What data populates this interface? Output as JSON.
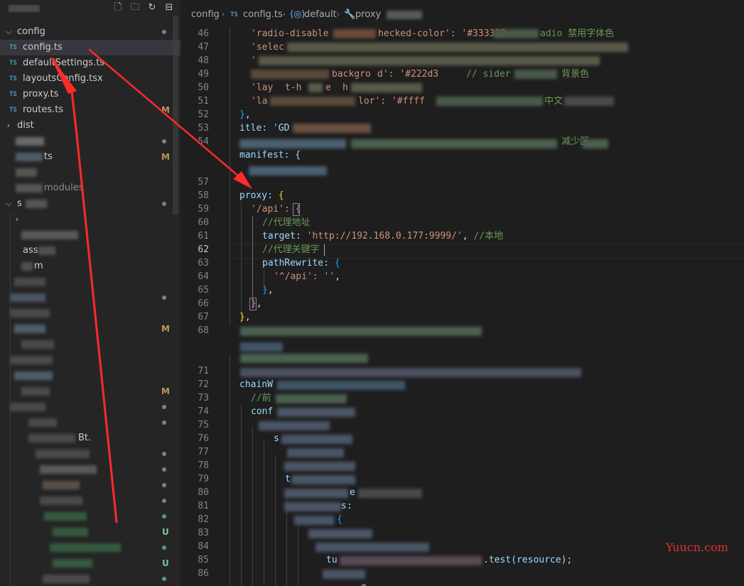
{
  "sidebar": {
    "actions": [
      "new-file-icon",
      "new-folder-icon",
      "refresh-icon",
      "collapse-all-icon"
    ],
    "folder": "config",
    "files": [
      {
        "name": "config.ts",
        "icon": "TS",
        "selected": true
      },
      {
        "name": "defaultSettings.ts",
        "icon": "TS"
      },
      {
        "name": "layoutsConfig.tsx",
        "icon": "TS"
      },
      {
        "name": "proxy.ts",
        "icon": "TS"
      },
      {
        "name": "routes.ts",
        "icon": "TS",
        "status": "M"
      }
    ],
    "dist": "dist",
    "partial": {
      "ts": "ts",
      "modules": "modules",
      "ass": "ass",
      "s": "s",
      "m": "m",
      "bt": "Bt."
    },
    "badges": {
      "m": "M",
      "u": "U"
    }
  },
  "breadcrumbs": {
    "folder": "config",
    "file": "config.ts",
    "symbol": "default",
    "prop": "proxy"
  },
  "line_numbers": [
    "46",
    "47",
    "48",
    "49",
    "50",
    "51",
    "52",
    "53",
    "54",
    "",
    "",
    "57",
    "58",
    "59",
    "60",
    "61",
    "62",
    "63",
    "64",
    "65",
    "66",
    "67",
    "68",
    "",
    "",
    "71",
    "72",
    "73",
    "74",
    "75",
    "76",
    "77",
    "78",
    "79",
    "80",
    "81",
    "82",
    "83",
    "84",
    "85",
    "86"
  ],
  "code": {
    "l46_a": "'radio-disable",
    "l46_b": "hecked-color': '#333333",
    "l46_c": "adio 禁用字体色",
    "l47": "'selec",
    "l49_a": "backgro",
    "l49_b": "d': '#222d3",
    "l49_c": "// sider",
    "l49_d": "背景色",
    "l50_a": "'lay",
    "l50_b": "t-h",
    "l50_c": "e",
    "l50_d": "h",
    "l51_a": "'la",
    "l51_b": "lor': '#ffff",
    "l51_c": "中文",
    "l53_a": "itle: 'GD",
    "l54": "减少区",
    "l55": "manifest: {",
    "l58": "proxy:",
    "l59": "'/api':",
    "l60": "//代理地址",
    "l61_key": "target:",
    "l61_val": "'http://192.168.0.177:9999/'",
    "l61_cmt": "//本地",
    "l62": "//代理关键字",
    "l63": "pathRewrite:",
    "l64_key": "'^/api':",
    "l64_val": "''",
    "l72": "chainW",
    "l73": "//前",
    "l74": "conf",
    "l76": "s",
    "l79": "t",
    "l80": "e",
    "l81": "s:",
    "l85_a": "tu",
    "l85_b": ".test(resource);",
    "l87": "e"
  },
  "watermark": "Yuucn.com",
  "colors": {
    "background": "#1e1e1e",
    "sidebar": "#252526",
    "string": "#ce9178",
    "comment": "#6a9955",
    "property": "#9cdcfe",
    "ts_icon": "#519aba",
    "modified": "#c09553",
    "untracked": "#73c991",
    "arrow": "#ff2a2a"
  }
}
